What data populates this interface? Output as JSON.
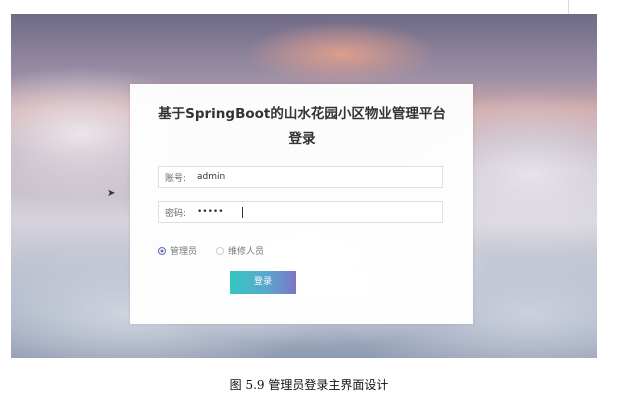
{
  "login": {
    "title": "基于SpringBoot的山水花园小区物业管理平台登录",
    "account_label": "账号:",
    "account_value": "admin",
    "password_label": "密码:",
    "password_value": "•••••",
    "roles": [
      "管理员",
      "维修人员"
    ],
    "selected_role": "管理员",
    "login_button": "登录"
  },
  "caption": "图 5.9  管理员登录主界面设计"
}
